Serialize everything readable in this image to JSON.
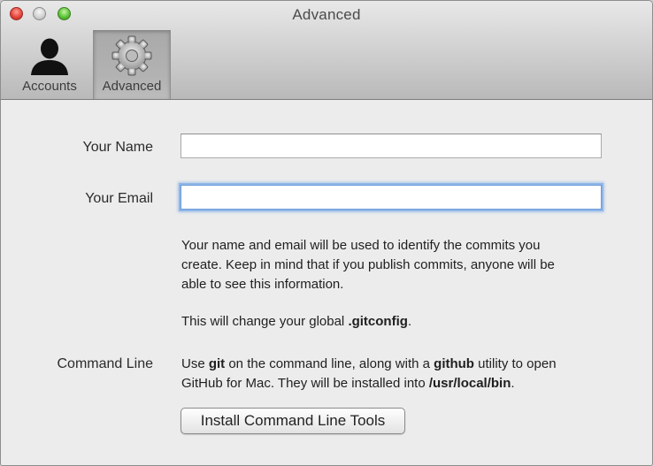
{
  "window": {
    "title": "Advanced"
  },
  "toolbar": {
    "tabs": [
      {
        "label": "Accounts",
        "icon": "person-icon",
        "selected": false
      },
      {
        "label": "Advanced",
        "icon": "gear-icon",
        "selected": true
      }
    ]
  },
  "form": {
    "name_label": "Your Name",
    "name_value": "",
    "email_label": "Your Email",
    "email_value": ""
  },
  "info": {
    "line1": "Your name and email will be used to identify the commits you",
    "line2": "create. Keep in mind that if you publish commits, anyone will be",
    "line3": "able to see this information.",
    "gitconfig_prefix": "This will change your global ",
    "gitconfig_file": ".gitconfig",
    "gitconfig_suffix": "."
  },
  "command_line": {
    "label": "Command Line",
    "part1": "Use ",
    "git": "git",
    "part2": " on the command line, along with a ",
    "github": "github",
    "part3": " utility to open",
    "part4": "GitHub for Mac. They will be installed into ",
    "path": "/usr/local/bin",
    "part5": ".",
    "button_label": "Install Command Line Tools"
  }
}
